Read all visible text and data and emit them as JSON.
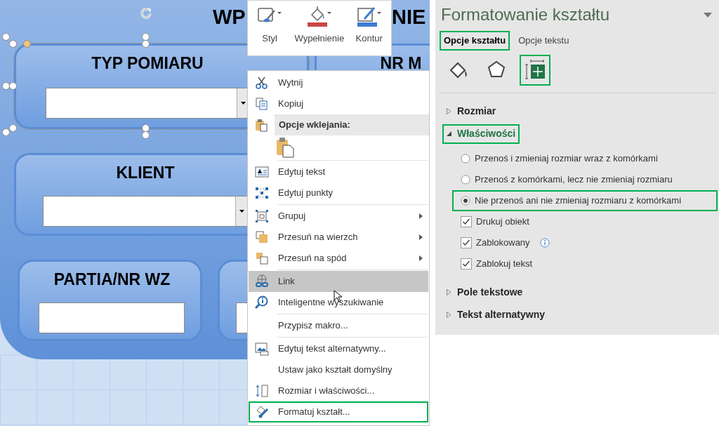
{
  "sheet": {
    "title_left": "WP",
    "title_right": "NIE",
    "shapes": [
      {
        "kind": "combo",
        "label": "TYP POMIARU",
        "selected": true
      },
      {
        "kind": "heading",
        "label": "NR M",
        "selected": false
      },
      {
        "kind": "combo",
        "label": "KLIENT",
        "selected": false
      },
      {
        "kind": "input",
        "label": "PARTIA/NR WZ",
        "selected": false
      },
      {
        "kind": "input",
        "selected": false
      }
    ]
  },
  "mini_toolbar": {
    "buttons": [
      {
        "label": "Styl"
      },
      {
        "label": "Wypełnienie"
      },
      {
        "label": "Kontur"
      }
    ]
  },
  "context_menu": {
    "groups": [
      [
        {
          "kind": "item",
          "label": "Wytnij",
          "hovered": false,
          "highlighted": false,
          "submenu": false
        },
        {
          "kind": "item",
          "label": "Kopiuj",
          "hovered": false,
          "highlighted": false,
          "submenu": false
        },
        {
          "kind": "header",
          "label": "Opcje wklejania:"
        },
        {
          "kind": "paste-options"
        }
      ],
      [
        {
          "kind": "item",
          "label": "Edytuj tekst",
          "hovered": false,
          "highlighted": false,
          "submenu": false
        },
        {
          "kind": "item",
          "label": "Edytuj punkty",
          "hovered": false,
          "highlighted": false,
          "submenu": false
        }
      ],
      [
        {
          "kind": "item",
          "label": "Grupuj",
          "hovered": false,
          "highlighted": false,
          "submenu": true
        },
        {
          "kind": "item",
          "label": "Przesuń na wierzch",
          "hovered": false,
          "highlighted": false,
          "submenu": true
        },
        {
          "kind": "item",
          "label": "Przesuń na spód",
          "hovered": false,
          "highlighted": false,
          "submenu": true
        }
      ],
      [
        {
          "kind": "item",
          "label": "Link",
          "hovered": true,
          "highlighted": false,
          "submenu": false
        },
        {
          "kind": "item",
          "label": "Inteligentne wyszukiwanie",
          "hovered": false,
          "highlighted": false,
          "submenu": false
        }
      ],
      [
        {
          "kind": "item",
          "label": "Przypisz makro...",
          "hovered": false,
          "highlighted": false,
          "submenu": false
        }
      ],
      [
        {
          "kind": "item",
          "label": "Edytuj tekst alternatywny...",
          "hovered": false,
          "highlighted": false,
          "submenu": false
        },
        {
          "kind": "item",
          "label": "Ustaw jako kształt domyślny",
          "hovered": false,
          "highlighted": false,
          "submenu": false
        },
        {
          "kind": "item",
          "label": "Rozmiar i właściwości...",
          "hovered": false,
          "highlighted": false,
          "submenu": false
        },
        {
          "kind": "item",
          "label": "Formatuj kształt...",
          "hovered": false,
          "highlighted": true,
          "submenu": false
        }
      ]
    ]
  },
  "format_pane": {
    "title": "Formatowanie kształtu",
    "tabs": [
      {
        "label": "Opcje kształtu",
        "selected": true,
        "highlighted": true
      },
      {
        "label": "Opcje tekstu",
        "selected": false,
        "highlighted": false
      }
    ],
    "icon_tabs": [
      {
        "selected": false,
        "highlighted": false
      },
      {
        "selected": false,
        "highlighted": false
      },
      {
        "selected": true,
        "highlighted": true
      }
    ],
    "sections": [
      {
        "label": "Rozmiar",
        "expanded": false,
        "highlighted": false
      },
      {
        "label": "Właściwości",
        "expanded": true,
        "highlighted": true,
        "options": [
          {
            "kind": "radio",
            "label": "Przenoś i zmieniaj rozmiar wraz z komórkami",
            "checked": false,
            "highlighted": false,
            "info": false
          },
          {
            "kind": "radio",
            "label": "Przenoś z komórkami, lecz nie zmieniaj rozmiaru",
            "checked": false,
            "highlighted": false,
            "info": false
          },
          {
            "kind": "radio",
            "label": "Nie przenoś ani nie zmieniaj rozmiaru z komórkami",
            "checked": true,
            "highlighted": true,
            "info": false
          },
          {
            "kind": "checkbox",
            "label": "Drukuj obiekt",
            "checked": true,
            "highlighted": false,
            "info": false
          },
          {
            "kind": "checkbox",
            "label": "Zablokowany",
            "checked": true,
            "highlighted": false,
            "info": true
          },
          {
            "kind": "checkbox",
            "label": "Zablokuj tekst",
            "checked": true,
            "highlighted": false,
            "info": false
          }
        ]
      },
      {
        "label": "Pole tekstowe",
        "expanded": false,
        "highlighted": false
      },
      {
        "label": "Tekst alternatywny",
        "expanded": false,
        "highlighted": false
      }
    ]
  }
}
